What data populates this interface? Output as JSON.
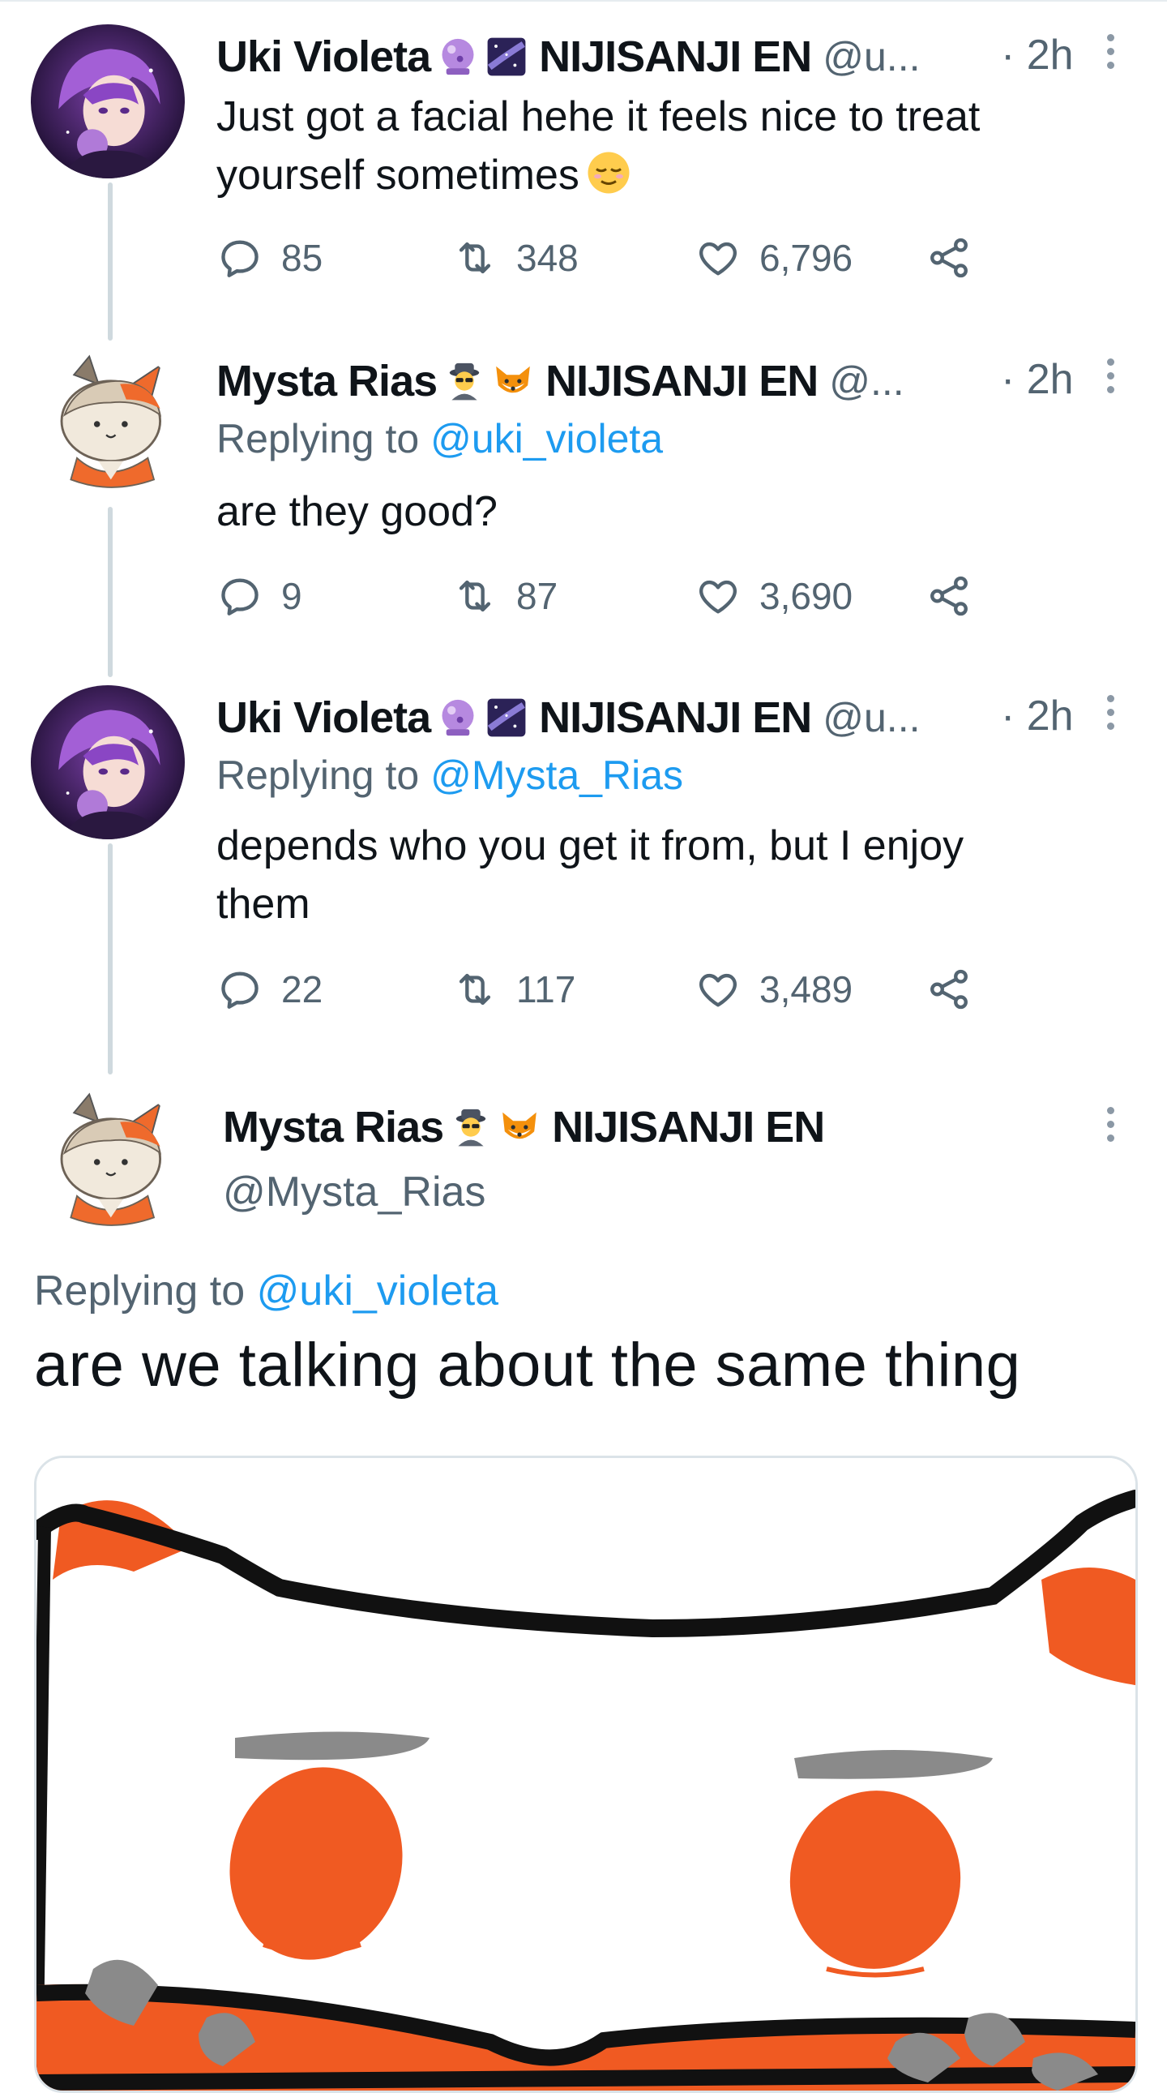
{
  "tweets": [
    {
      "name": "Uki Violeta",
      "emojis": [
        "crystal-ball",
        "milky-way"
      ],
      "affiliation": "NIJISANJI EN",
      "handle": "@u...",
      "time": "· 2h",
      "text_line1": "Just got a facial hehe it feels nice to treat",
      "text_line2": "yourself sometimes",
      "text_emoji": "relieved-face",
      "replies": "85",
      "retweets": "348",
      "likes": "6,796"
    },
    {
      "name": "Mysta Rias",
      "emojis": [
        "detective",
        "fox"
      ],
      "affiliation": "NIJISANJI EN",
      "handle": "@...",
      "time": "· 2h",
      "replying_prefix": "Replying to",
      "replying_to": "@uki_violeta",
      "text_line1": "are they good?",
      "replies": "9",
      "retweets": "87",
      "likes": "3,690"
    },
    {
      "name": "Uki Violeta",
      "emojis": [
        "crystal-ball",
        "milky-way"
      ],
      "affiliation": "NIJISANJI EN",
      "handle": "@u...",
      "time": "· 2h",
      "replying_prefix": "Replying to",
      "replying_to": "@Mysta_Rias",
      "text_line1": "depends who you get it from, but I enjoy",
      "text_line2": "them",
      "replies": "22",
      "retweets": "117",
      "likes": "3,489"
    }
  ],
  "main_tweet": {
    "name": "Mysta Rias",
    "emojis": [
      "detective",
      "fox"
    ],
    "affiliation": "NIJISANJI EN",
    "handle": "@Mysta_Rias",
    "replying_prefix": "Replying to",
    "replying_to": "@uki_violeta",
    "text": "are we talking about the same thing"
  },
  "icons": {
    "reply": "reply-icon",
    "retweet": "retweet-icon",
    "like": "heart-icon",
    "share": "share-icon",
    "more": "more-vertical-icon"
  },
  "colors": {
    "text": "#0f1419",
    "secondary": "#536471",
    "link": "#1d9bf0",
    "thread_line": "#cfd9de",
    "drawing_orange": "#f05a22",
    "drawing_gray": "#8a8a8a"
  }
}
